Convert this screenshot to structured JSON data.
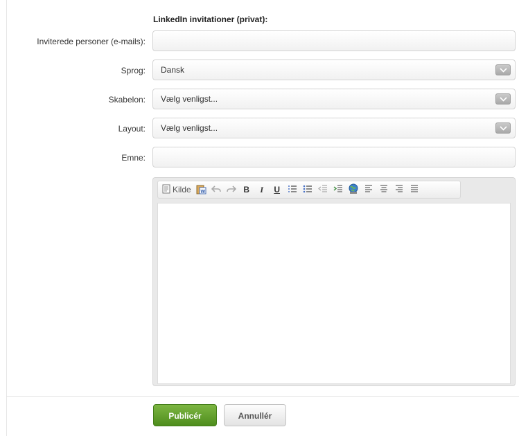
{
  "form": {
    "section_title": "LinkedIn invitationer (privat):",
    "invited": {
      "label": "Inviterede personer (e-mails):",
      "value": "",
      "placeholder": ""
    },
    "language": {
      "label": "Sprog:",
      "value": "Dansk"
    },
    "template": {
      "label": "Skabelon:",
      "value": "Vælg venligst..."
    },
    "layout": {
      "label": "Layout:",
      "value": "Vælg venligst..."
    },
    "subject": {
      "label": "Emne:",
      "value": "",
      "placeholder": ""
    }
  },
  "editor": {
    "toolbar": {
      "source_label": "Kilde",
      "bold": "B",
      "italic": "I",
      "underline": "U",
      "icons": [
        "source-icon",
        "paste-word-icon",
        "undo-icon",
        "redo-icon",
        "bold-icon",
        "italic-icon",
        "underline-icon",
        "numbered-list-icon",
        "bulleted-list-icon",
        "outdent-icon",
        "indent-icon",
        "link-icon",
        "align-left-icon",
        "align-center-icon",
        "align-right-icon",
        "align-justify-icon"
      ]
    },
    "content": ""
  },
  "actions": {
    "publish": "Publicér",
    "cancel": "Annullér"
  },
  "colors": {
    "primary_button": "#5fa02a",
    "border": "#d3d3d3"
  }
}
